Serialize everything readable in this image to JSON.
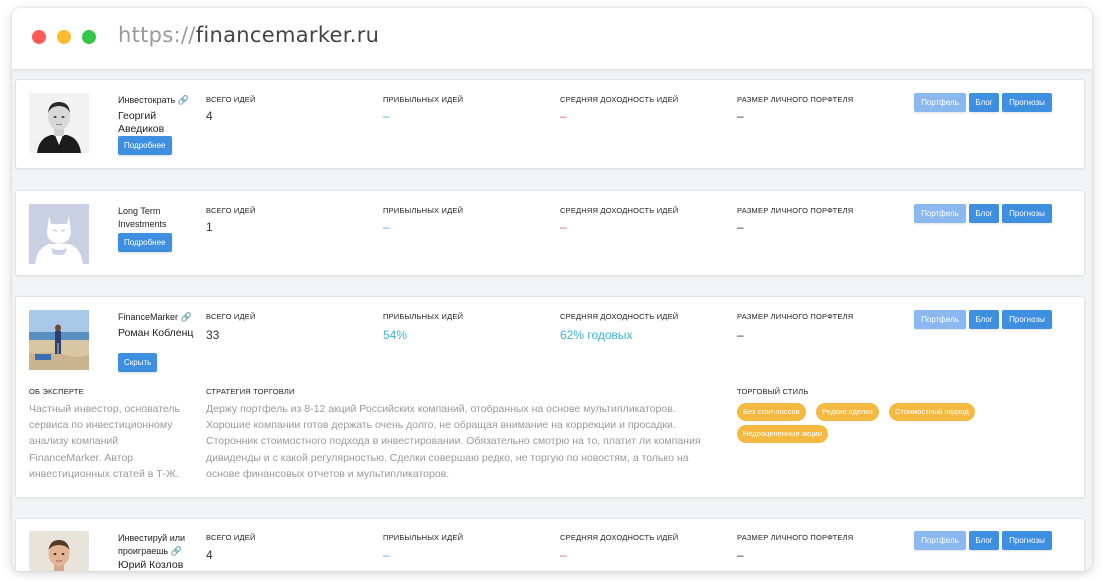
{
  "browser": {
    "url_scheme": "https://",
    "url_host": "financemarker.ru"
  },
  "labels": {
    "total_ideas": "ВСЕГО ИДЕЙ",
    "profitable_ideas": "ПРИБЫЛЬНЫХ ИДЕЙ",
    "avg_return": "СРЕДНЯЯ ДОХОДНОСТЬ ИДЕЙ",
    "portfolio_size": "РАЗМЕР ЛИЧНОГО ПОРФТЕЛЯ",
    "portfolio_btn": "Портфель",
    "blog_btn": "Блог",
    "forecasts_btn": "Прогнозы",
    "about_expert": "ОБ ЭКСПЕРТЕ",
    "strategy": "СТРАТЕГИЯ ТОРГОВЛИ",
    "trading_style": "ТОРГОВЫЙ СТИЛЬ"
  },
  "experts": [
    {
      "handle": "Инвестократь",
      "name": "Георгий Аведиков",
      "more_button": "Подробнее",
      "total_ideas": "4",
      "profitable": "–",
      "avg_return": "–",
      "portfolio_size": "–"
    },
    {
      "handle": "Long Term Investments",
      "name": "",
      "more_button": "Подробнее",
      "total_ideas": "1",
      "profitable": "–",
      "avg_return": "–",
      "portfolio_size": "–"
    },
    {
      "handle": "FinanceMarker",
      "name": "Роман Кобленц",
      "more_button": "Скрыть",
      "total_ideas": "33",
      "profitable": "54%",
      "avg_return": "62% годовых",
      "portfolio_size": "–",
      "about": "Частный инвестор, основатель сервиса по инвестиционному анализу компаний FinanceMarker. Автор инвестиционных статей в Т-Ж.",
      "strategy": "Держу портфель из 8-12 акций Российских компаний, отобранных на основе мультипликаторов. Хорошие компании готов держать очень долго, не обращая внимание на коррекции и просадки. Сторонник стоимостного подхода в инвестировании. Обязательно смотрю на то, платит ли компания дивиденды и с какой регулярностью. Сделки совершаю редко, не торгую по новостям, а только на основе финансовых отчетов и мультипликаторов.",
      "tags": [
        "Без стоп-лоссов",
        "Редкие сделки",
        "Стоимостный подход",
        "Недооцененные акции"
      ]
    },
    {
      "handle": "Инвестируй или проиграешь",
      "name": "Юрий Козлов",
      "more_button": "",
      "total_ideas": "4",
      "profitable": "–",
      "avg_return": "–",
      "portfolio_size": "–"
    }
  ],
  "colors": {
    "primary": "#3f8fe0",
    "accent_text": "#3bb3d6",
    "negative": "#e05a5a",
    "tag": "#f5b942"
  }
}
